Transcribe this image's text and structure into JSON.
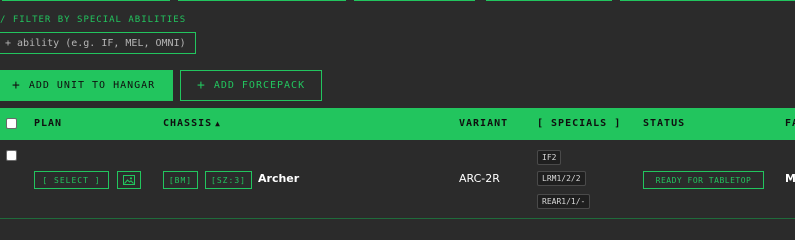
{
  "filters": {
    "label": "/ FILTER BY SPECIAL ABILITIES",
    "ability_placeholder": "+ ability (e.g. IF, MEL, OMNI)"
  },
  "actions": {
    "add_unit_label": "ADD UNIT TO HANGAR",
    "add_forcepack_label": "ADD FORCEPACK",
    "plus_glyph": "+"
  },
  "table": {
    "headers": {
      "plan": "PLAN",
      "chassis": "CHASSIS",
      "variant": "VARIANT",
      "specials": "[ SPECIALS ]",
      "status": "STATUS",
      "faction_cut": "FA"
    },
    "chassis_sort_glyph": "▲",
    "rows": [
      {
        "select_label": "[ SELECT ]",
        "tag_bm": "[BM]",
        "tag_sz": "[SZ:3]",
        "chassis": "Archer",
        "variant": "ARC-2R",
        "specials": [
          "IF2",
          "LRM1/2/2",
          "REAR1/1/-"
        ],
        "status": "READY FOR TABLETOP",
        "faction_cut": "M"
      }
    ]
  },
  "colors": {
    "accent": "#22c55e",
    "background": "#2b2b2b",
    "text": "#e6e6e6"
  },
  "icons": {
    "image": "image-icon"
  }
}
